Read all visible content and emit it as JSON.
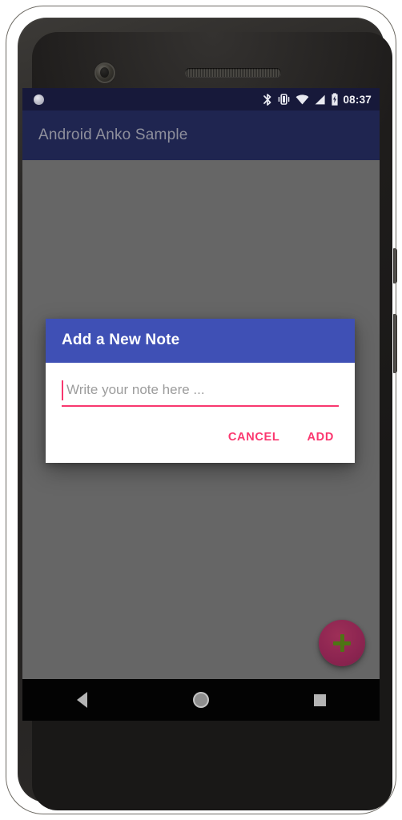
{
  "device": {
    "hardware": {
      "front_camera": "front-camera",
      "earpiece": "earpiece-speaker",
      "proximity_sensor": "proximity-sensor",
      "power_button": "power-button",
      "volume_button": "volume-rocker"
    }
  },
  "status_bar": {
    "notification_icon": "notification-dot-icon",
    "icons": [
      {
        "name": "bluetooth-icon"
      },
      {
        "name": "vibrate-icon"
      },
      {
        "name": "wifi-icon"
      },
      {
        "name": "cell-signal-icon"
      },
      {
        "name": "battery-charging-icon"
      }
    ],
    "clock": "08:37",
    "background_color": "#17193a"
  },
  "app_bar": {
    "title": "Android Anko Sample",
    "background_color": "#1f2550",
    "title_color": "#8e8f9c"
  },
  "content": {
    "scrim_color": "#666666",
    "fab": {
      "name": "add-note-fab",
      "icon": "plus-icon",
      "background_color": "#8d2551",
      "icon_color": "#4e7414"
    }
  },
  "dialog": {
    "title": "Add a New Note",
    "header_color": "#3f50b5",
    "accent_color": "#fb376f",
    "input": {
      "placeholder": "Write your note here ...",
      "value": "",
      "cursor_visible": true
    },
    "buttons": [
      {
        "name": "cancel-button",
        "label": "CANCEL"
      },
      {
        "name": "add-button",
        "label": "ADD"
      }
    ]
  },
  "navigation_bar": {
    "background_color": "#030303",
    "keys": [
      {
        "name": "nav-back-button",
        "icon": "back-triangle-icon"
      },
      {
        "name": "nav-home-button",
        "icon": "home-circle-icon"
      },
      {
        "name": "nav-recents-button",
        "icon": "recents-square-icon"
      }
    ]
  }
}
